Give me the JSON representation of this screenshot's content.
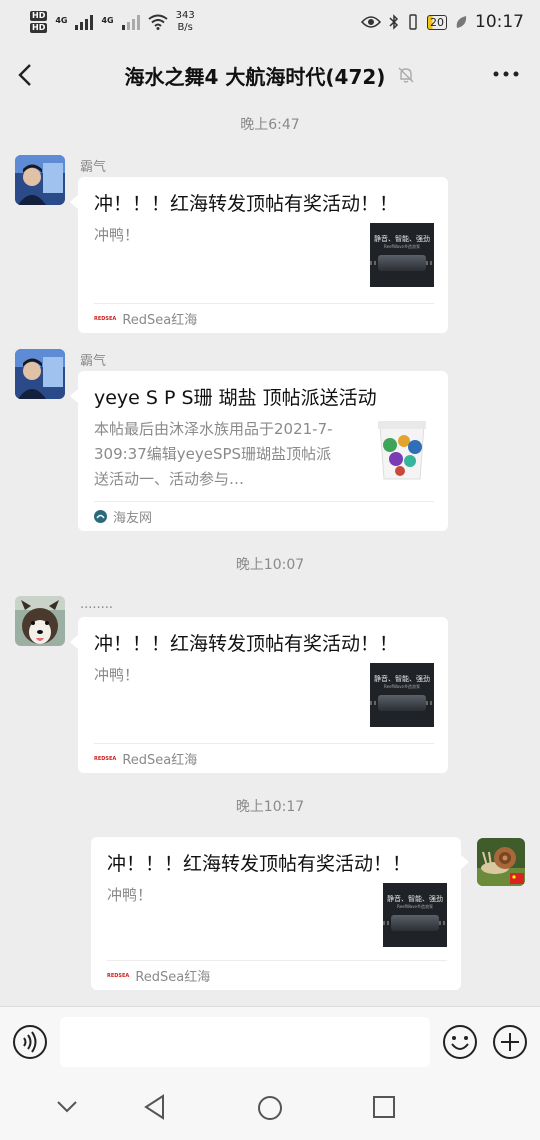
{
  "status_bar": {
    "hd1": "HD",
    "hd2": "HD",
    "net1": "4G",
    "net2": "4G",
    "speed_value": "343",
    "speed_unit": "B/s",
    "battery": "20",
    "time": "10:17"
  },
  "header": {
    "title": "海水之舞4 大航海时代(472)"
  },
  "timestamps": [
    "晚上6:47",
    "晚上10:07",
    "晚上10:17"
  ],
  "messages": [
    {
      "sender": "霸气",
      "title": "冲！！！红海转发顶帖有奖活动！！",
      "desc": "冲鸭！",
      "thumb_text": "静音、智能、强劲",
      "thumb_sub": "ReefWave®造浪泵",
      "source": "RedSea红海",
      "source_logo": "REDSEA"
    },
    {
      "sender": "霸气",
      "title": "yeye S P S珊 瑚盐 顶帖派送活动",
      "desc": "本帖最后由沐泽水族用品于2021-7-309:37编辑yeyeSPS珊瑚盐顶帖派送活动一、活动参与…",
      "source": "海友网"
    },
    {
      "sender": "........",
      "title": "冲！！！红海转发顶帖有奖活动！！",
      "desc": "冲鸭！",
      "thumb_text": "静音、智能、强劲",
      "thumb_sub": "ReefWave®造浪泵",
      "source": "RedSea红海",
      "source_logo": "REDSEA"
    },
    {
      "title": "冲！！！红海转发顶帖有奖活动！！",
      "desc": "冲鸭！",
      "thumb_text": "静音、智能、强劲",
      "thumb_sub": "ReefWave®造浪泵",
      "source": "RedSea红海",
      "source_logo": "REDSEA"
    }
  ],
  "input": {
    "value": "",
    "placeholder": ""
  }
}
